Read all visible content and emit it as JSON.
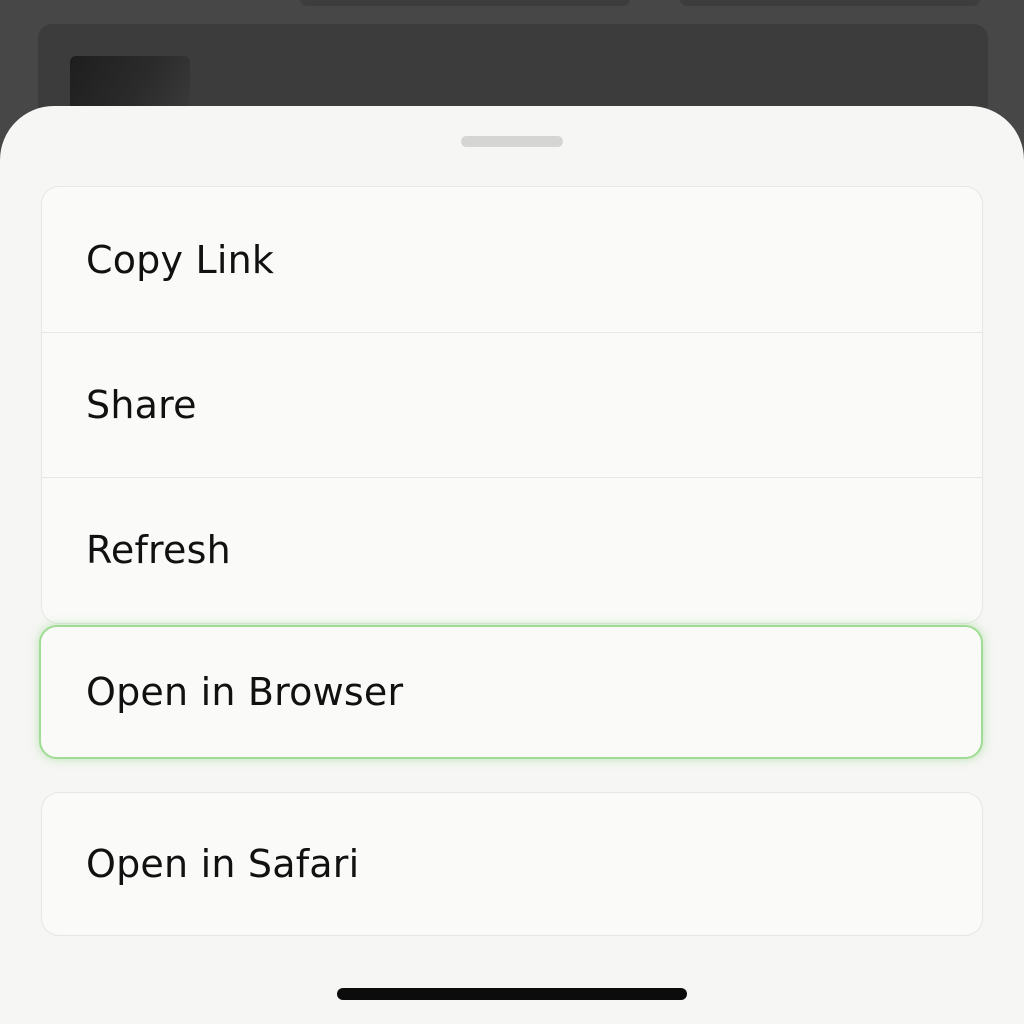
{
  "sheet": {
    "actions": [
      {
        "label": "Copy Link"
      },
      {
        "label": "Share"
      },
      {
        "label": "Refresh"
      }
    ],
    "highlighted_action": {
      "label": "Open in Browser"
    },
    "secondary_action": {
      "label": "Open in Safari"
    }
  },
  "colors": {
    "sheet_background": "#f6f6f4",
    "highlight_border": "#9fdc94",
    "text": "#111111"
  }
}
